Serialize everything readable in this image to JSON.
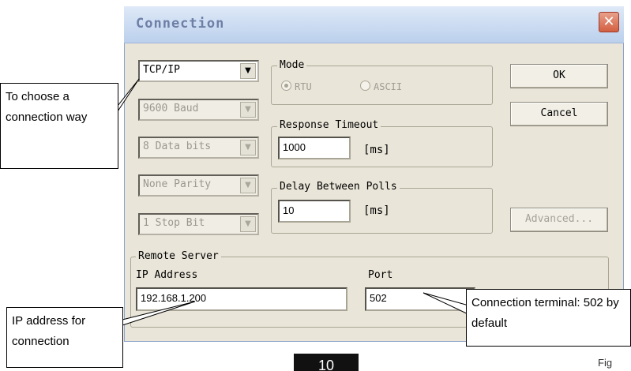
{
  "dialog": {
    "title": "Connection",
    "close_symbol": "✕"
  },
  "connection_type": {
    "value": "TCP/IP"
  },
  "serial": {
    "baud": "9600 Baud",
    "data_bits": "8 Data bits",
    "parity": "None Parity",
    "stop_bits": "1 Stop Bit"
  },
  "mode": {
    "label": "Mode",
    "options": [
      "RTU",
      "ASCII"
    ],
    "selected": "RTU"
  },
  "response_timeout": {
    "label": "Response Timeout",
    "value": "1000",
    "unit": "[ms]"
  },
  "delay_between_polls": {
    "label": "Delay Between Polls",
    "value": "10",
    "unit": "[ms]"
  },
  "buttons": {
    "ok": "OK",
    "cancel": "Cancel",
    "advanced": "Advanced..."
  },
  "remote_server": {
    "label": "Remote Server",
    "ip_label": "IP Address",
    "ip_value": "192.168.1.200",
    "port_label": "Port",
    "port_value": "502"
  },
  "callouts": {
    "connection_way": "To  choose a connection way",
    "ip_address": "IP address for connection",
    "port": "Connection terminal: 502 by default"
  },
  "page_number": "10",
  "fig_label": "Fig"
}
